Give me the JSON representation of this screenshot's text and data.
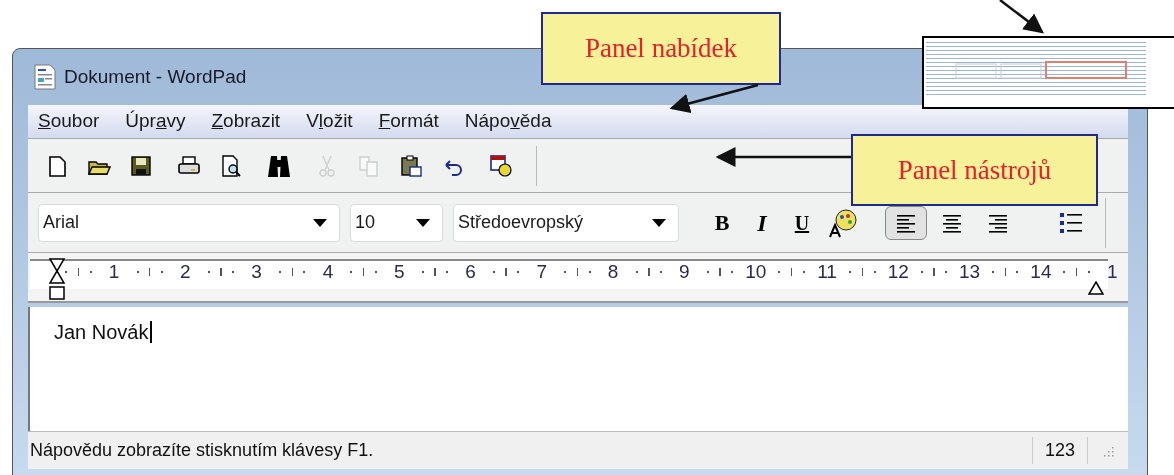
{
  "window": {
    "title": "Dokument - WordPad"
  },
  "menu": [
    {
      "key": "S",
      "after": "oubor"
    },
    {
      "before": "Úpr",
      "key": "a",
      "after": "vy"
    },
    {
      "key": "Z",
      "after": "obrazit"
    },
    {
      "before": "V",
      "key": "l",
      "after": "ožit"
    },
    {
      "key": "F",
      "after": "ormát"
    },
    {
      "before": "Nápo",
      "key": "v",
      "after": "ěda"
    }
  ],
  "toolbar": {
    "buttons": [
      {
        "disabled": false
      },
      {
        "disabled": false
      },
      {
        "disabled": false
      },
      {
        "disabled": false
      },
      {
        "disabled": false
      },
      {
        "disabled": false
      },
      {
        "disabled": true
      },
      {
        "disabled": true
      },
      {
        "disabled": false
      },
      {
        "disabled": false
      },
      {
        "disabled": false
      }
    ]
  },
  "format_bar": {
    "font": "Arial",
    "size": "10",
    "script": "Středoevropský",
    "bold": "B",
    "italic": "I",
    "underline": "U",
    "alignment": [
      {
        "selected": true
      },
      {
        "selected": false
      },
      {
        "selected": false
      }
    ]
  },
  "ruler": {
    "labels": [
      "1",
      "2",
      "3",
      "4",
      "5",
      "6",
      "7",
      "8",
      "9",
      "10",
      "11",
      "12",
      "13",
      "14",
      "1"
    ]
  },
  "document": {
    "text": "Jan Novák"
  },
  "status_bar": {
    "text": "Nápovědu zobrazíte stisknutím klávesy F1.",
    "indicator": "123"
  },
  "annotations": [
    {
      "text": "Panel nabídek"
    },
    {
      "text": "Panel nástrojů"
    }
  ]
}
